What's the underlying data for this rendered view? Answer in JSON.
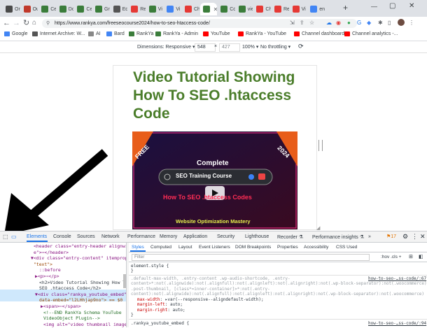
{
  "browser": {
    "tabs": [
      {
        "label": "On",
        "color": "#4a4a4a"
      },
      {
        "label": "Ou",
        "color": "#c0392b"
      },
      {
        "label": "Ce",
        "color": "#3b7d3b"
      },
      {
        "label": "Do",
        "color": "#3b7d3b"
      },
      {
        "label": "Ce",
        "color": "#3b7d3b"
      },
      {
        "label": "Gr",
        "color": "#3b7d3b"
      },
      {
        "label": "Ed",
        "color": "#555555"
      },
      {
        "label": "Re",
        "color": "#e53935"
      },
      {
        "label": "Vi",
        "color": "#3b7d3b"
      },
      {
        "label": "Vi",
        "color": "#4285f4"
      },
      {
        "label": "Ch",
        "color": "#e53935"
      },
      {
        "label": "",
        "color": "#3b7d3b"
      },
      {
        "label": "Co",
        "color": "#3b7d3b"
      },
      {
        "label": "vie",
        "color": "#3b7d3b"
      },
      {
        "label": "Ch",
        "color": "#e53935"
      },
      {
        "label": "Re",
        "color": "#e53935"
      },
      {
        "label": "Vi",
        "color": "#e53935"
      },
      {
        "label": "en",
        "color": "#4285f4"
      }
    ],
    "url": "https://www.rankya.com/freeseocourse2024/how-to-seo-htaccess-code/",
    "bookmarks": [
      {
        "label": "Google",
        "color": "#4285f4"
      },
      {
        "label": "Internet Archive: W...",
        "color": "#555555"
      },
      {
        "label": "AI",
        "color": "#888888"
      },
      {
        "label": "Bard",
        "color": "#4285f4"
      },
      {
        "label": "RankYa",
        "color": "#3b7d3b"
      },
      {
        "label": "RankYa - Admin",
        "color": "#3b7d3b"
      },
      {
        "label": "YouTube",
        "color": "#ff0000"
      },
      {
        "label": "RankYa - YouTube",
        "color": "#ff0000"
      },
      {
        "label": "Channel dashboard...",
        "color": "#ff0000"
      },
      {
        "label": "Channel analytics -...",
        "color": "#ff0000"
      }
    ]
  },
  "device_toolbar": {
    "dimensions": "Dimensions: Responsive ▾",
    "width": "548",
    "x": "×",
    "height": "427",
    "zoom": "100% ▾",
    "throttle": "No throttling ▾"
  },
  "page": {
    "title": "Video Tutorial Showing How To SEO .htaccess Code",
    "video": {
      "badge_free": "FREE",
      "badge_year": "2024",
      "complete": "Complete",
      "search_text": "SEO Training Course",
      "headline": "How To SEO .htaccess Codes",
      "footer": "Website Optimization Mastery"
    }
  },
  "devtools": {
    "tabs": [
      "Elements",
      "Console",
      "Sources",
      "Network",
      "Performance",
      "Memory",
      "Application",
      "Security",
      "Lighthouse",
      "Recorder ⚗",
      "Performance insights ⚗",
      "»"
    ],
    "issues_count": "17",
    "dom_lines": [
      "<header class=\"entry-header alignwi",
      "e\">⋯</header>",
      "▼<div class=\"entry-content\" itemprop=",
      "\"text\">",
      "::before",
      "▶<p>⋯</p>",
      "<h2>Video Tutorial Showing How To",
      "SEO .htaccess Code</h2>",
      "▼<div class=\"rankya_youtube_embed\"",
      "data-embed=\"l2LHhjap9no\"> == $0",
      "▶<span>⋯</span>",
      "<!--END RankYa Schema YouTube",
      "VideoObject Plugin-->",
      "<img alt=\"video thumbnail image\""
    ],
    "styles_tabs": [
      "Styles",
      "Computed",
      "Layout",
      "Event Listeners",
      "DOM Breakpoints",
      "Properties",
      "Accessibility",
      "CSS Used"
    ],
    "filter_placeholder": "Filter",
    "filter_tools": ":hov  .cls  +",
    "rules": {
      "element_style": "element.style {",
      "close1": "}",
      "selector_lines": [
        ".default-max-width, .entry-content .wp-audio-shortcode, .entry-",
        "content>*:not(.alignwide):not(.alignfull):not(.alignleft):not(.alignright):not(.wp-block-separator):not(.woocommerce),",
        ".post-thumbnail, [class*=inner-container]>*:not(.entry-",
        "content):not(.alignwide):not(.alignfull):not(.alignleft):not(.alignright):not(.wp-block-separator):not(.woocommerce) {"
      ],
      "source1": "how-to-seo-…ss-code/:67",
      "props": [
        {
          "name": "max-width",
          "value": ": ▸var(--responsive--aligndefault-width);"
        },
        {
          "name": "margin-left",
          "value": ": auto;"
        },
        {
          "name": "margin-right",
          "value": ": auto;"
        }
      ],
      "close2": "}",
      "last_selector": ".rankya_youtube_embed {",
      "source2": "how-to-seo-…ss-code/:94"
    }
  }
}
